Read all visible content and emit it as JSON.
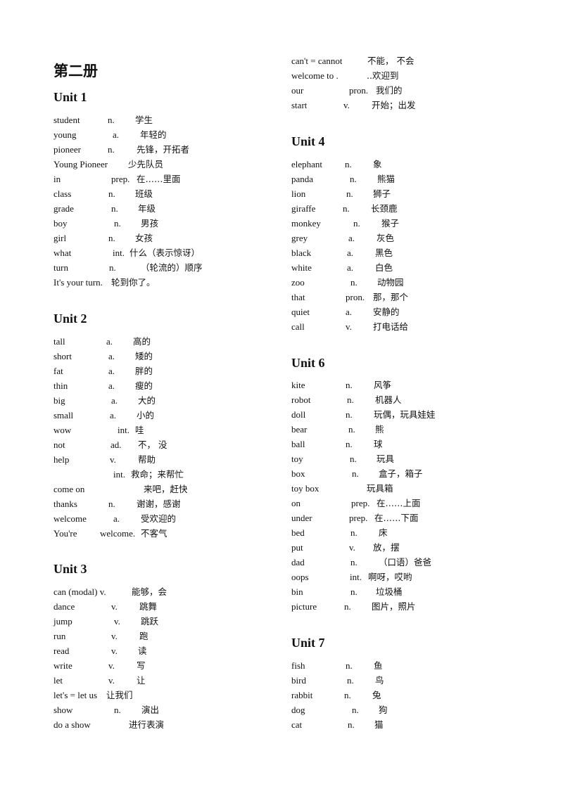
{
  "book_title": "第二册",
  "units": {
    "u1": {
      "title": "Unit 1",
      "rows": [
        {
          "word": "student",
          "pos": "n.",
          "meaning": "学生"
        },
        {
          "word": "young",
          "pos": "a.",
          "meaning": "年轻的"
        },
        {
          "word": "pioneer",
          "pos": "n.",
          "meaning": "先锋，开拓者"
        },
        {
          "word": "Young Pioneer",
          "pos": "",
          "meaning": "少先队员"
        },
        {
          "word": "in",
          "pos": "prep.",
          "meaning": "在……里面"
        },
        {
          "word": "class",
          "pos": "n.",
          "meaning": "班级"
        },
        {
          "word": "grade",
          "pos": "n.",
          "meaning": "年级"
        },
        {
          "word": "boy",
          "pos": "n.",
          "meaning": "男孩"
        },
        {
          "word": "girl",
          "pos": "n.",
          "meaning": "女孩"
        },
        {
          "word": "what",
          "pos": "int.",
          "meaning": "什么（表示惊讶）"
        },
        {
          "word": "turn",
          "pos": "n.",
          "meaning": "（轮流的）顺序"
        },
        {
          "word": "It's your turn.",
          "pos": "",
          "meaning": "轮到你了。"
        }
      ]
    },
    "u2": {
      "title": "Unit 2",
      "rows": [
        {
          "word": "tall",
          "pos": "a.",
          "meaning": "高的"
        },
        {
          "word": "short",
          "pos": "a.",
          "meaning": "矮的"
        },
        {
          "word": "fat",
          "pos": "a.",
          "meaning": "胖的"
        },
        {
          "word": "thin",
          "pos": "a.",
          "meaning": "瘦的"
        },
        {
          "word": "big",
          "pos": "a.",
          "meaning": "大的"
        },
        {
          "word": "small",
          "pos": "a.",
          "meaning": "小的"
        },
        {
          "word": "wow",
          "pos": "int.",
          "meaning": "哇"
        },
        {
          "word": "not",
          "pos": "ad.",
          "meaning": "不，  没"
        },
        {
          "word": "help",
          "pos": "v.",
          "meaning": "帮助"
        },
        {
          "word": "",
          "pos": "int.",
          "meaning": "救命；来帮忙"
        },
        {
          "word": "come on",
          "pos": "",
          "meaning": "来吧，赶快"
        },
        {
          "word": "thanks",
          "pos": "n.",
          "meaning": "谢谢，感谢"
        },
        {
          "word": "welcome",
          "pos": "a.",
          "meaning": "受欢迎的"
        },
        {
          "word": "You're",
          "pos": "welcome.",
          "meaning": "不客气"
        }
      ]
    },
    "u3": {
      "title": "Unit 3",
      "rows": [
        {
          "word": "can (modal) v.",
          "pos": "",
          "meaning": "能够，会"
        },
        {
          "word": "dance",
          "pos": "v.",
          "meaning": "跳舞"
        },
        {
          "word": "jump",
          "pos": "v.",
          "meaning": "跳跃"
        },
        {
          "word": "run",
          "pos": "v.",
          "meaning": "跑"
        },
        {
          "word": "read",
          "pos": "v.",
          "meaning": "读"
        },
        {
          "word": "write",
          "pos": "v.",
          "meaning": "写"
        },
        {
          "word": "let",
          "pos": "v.",
          "meaning": "让"
        },
        {
          "word": "let's = let us",
          "pos": "",
          "meaning": "让我们"
        },
        {
          "word": "show",
          "pos": "n.",
          "meaning": "演出"
        },
        {
          "word": "do a show",
          "pos": "",
          "meaning": "进行表演"
        },
        {
          "word": "can't = cannot",
          "pos": "",
          "meaning": "不能，  不会"
        },
        {
          "word": "welcome to .",
          "pos": "",
          "meaning": "..欢迎到"
        },
        {
          "word": "our",
          "pos": "pron.",
          "meaning": "我们的"
        },
        {
          "word": "start",
          "pos": "v.",
          "meaning": "开始；出发"
        }
      ]
    },
    "u4": {
      "title": "Unit 4",
      "rows": [
        {
          "word": "elephant",
          "pos": "n.",
          "meaning": "象"
        },
        {
          "word": "panda",
          "pos": "n.",
          "meaning": "熊猫"
        },
        {
          "word": "lion",
          "pos": "n.",
          "meaning": "狮子"
        },
        {
          "word": "giraffe",
          "pos": "n.",
          "meaning": "长颈鹿"
        },
        {
          "word": "monkey",
          "pos": "n.",
          "meaning": "猴子"
        },
        {
          "word": "grey",
          "pos": "a.",
          "meaning": "灰色"
        },
        {
          "word": "black",
          "pos": "a.",
          "meaning": "黑色"
        },
        {
          "word": "white",
          "pos": "a.",
          "meaning": "白色"
        },
        {
          "word": "zoo",
          "pos": "n.",
          "meaning": "动物园"
        },
        {
          "word": "that",
          "pos": "pron.",
          "meaning": "那，那个"
        },
        {
          "word": "quiet",
          "pos": "a.",
          "meaning": "安静的"
        },
        {
          "word": "call",
          "pos": "v.",
          "meaning": "打电话给"
        }
      ]
    },
    "u6": {
      "title": "Unit 6",
      "rows": [
        {
          "word": "kite",
          "pos": "n.",
          "meaning": "风筝"
        },
        {
          "word": "robot",
          "pos": "n.",
          "meaning": "机器人"
        },
        {
          "word": "doll",
          "pos": "n.",
          "meaning": "玩偶，玩具娃娃"
        },
        {
          "word": "bear",
          "pos": "n.",
          "meaning": "熊"
        },
        {
          "word": "ball",
          "pos": "n.",
          "meaning": "球"
        },
        {
          "word": "toy",
          "pos": "n.",
          "meaning": "玩具"
        },
        {
          "word": "box",
          "pos": "n.",
          "meaning": "盒子，箱子"
        },
        {
          "word": "toy box",
          "pos": "",
          "meaning": "玩具箱"
        },
        {
          "word": "on",
          "pos": "prep.",
          "meaning": "在……上面"
        },
        {
          "word": "under",
          "pos": "prep.",
          "meaning": "在……下面"
        },
        {
          "word": "bed",
          "pos": "n.",
          "meaning": "床"
        },
        {
          "word": "put",
          "pos": "v.",
          "meaning": "放，摆"
        },
        {
          "word": "dad",
          "pos": "n.",
          "meaning": "（口语）爸爸"
        },
        {
          "word": "oops",
          "pos": "int.",
          "meaning": "啊呀，哎哟"
        },
        {
          "word": "bin",
          "pos": "n.",
          "meaning": "垃圾桶"
        },
        {
          "word": "picture",
          "pos": "n.",
          "meaning": "图片，照片"
        }
      ]
    },
    "u7": {
      "title": "Unit 7",
      "rows": [
        {
          "word": "fish",
          "pos": "n.",
          "meaning": "鱼"
        },
        {
          "word": "bird",
          "pos": "n.",
          "meaning": "鸟"
        },
        {
          "word": "rabbit",
          "pos": "n.",
          "meaning": "兔"
        },
        {
          "word": "dog",
          "pos": "n.",
          "meaning": "狗"
        },
        {
          "word": "cat",
          "pos": "n.",
          "meaning": "猫"
        }
      ]
    }
  }
}
